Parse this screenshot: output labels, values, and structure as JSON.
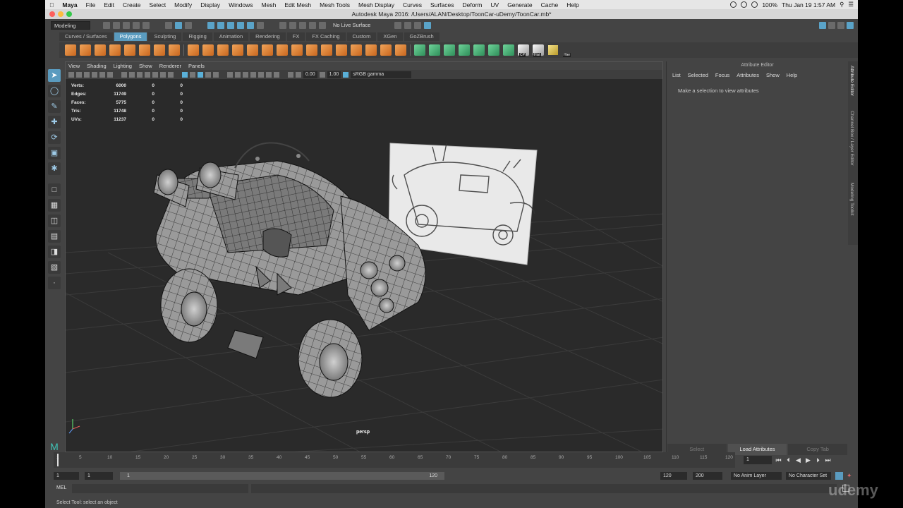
{
  "os_menubar": {
    "apple": "",
    "items": [
      "Maya",
      "File",
      "Edit",
      "Create",
      "Select",
      "Modify",
      "Display",
      "Windows",
      "Mesh",
      "Edit Mesh",
      "Mesh Tools",
      "Mesh Display",
      "Curves",
      "Surfaces",
      "Deform",
      "UV",
      "Generate",
      "Cache",
      "Help"
    ],
    "battery": "100%",
    "clock": "Thu Jan 19  1:57 AM"
  },
  "window": {
    "title": "Autodesk Maya 2016: /Users/ALAN/Desktop/ToonCar-uDemy/ToonCar.mb*"
  },
  "status_line": {
    "menu_set": "Modeling",
    "live_surface": "No Live Surface"
  },
  "shelf": {
    "tabs": [
      "Curves / Surfaces",
      "Polygons",
      "Sculpting",
      "Rigging",
      "Animation",
      "Rendering",
      "FX",
      "FX Caching",
      "Custom",
      "XGen",
      "GoZBrush"
    ],
    "active_tab": "Polygons",
    "labels": {
      "cp": "CP",
      "hist": "Hist",
      "hier": "Hier"
    }
  },
  "viewport": {
    "menu": [
      "View",
      "Shading",
      "Lighting",
      "Show",
      "Renderer",
      "Panels"
    ],
    "exposure": "0.00",
    "gamma": "1.00",
    "color_space": "sRGB gamma",
    "camera": "persp",
    "hud": [
      {
        "label": "Verts:",
        "value": "6000",
        "sel": "0",
        "comp": "0"
      },
      {
        "label": "Edges:",
        "value": "11749",
        "sel": "0",
        "comp": "0"
      },
      {
        "label": "Faces:",
        "value": "5775",
        "sel": "0",
        "comp": "0"
      },
      {
        "label": "Tris:",
        "value": "11748",
        "sel": "0",
        "comp": "0"
      },
      {
        "label": "UVs:",
        "value": "11237",
        "sel": "0",
        "comp": "0"
      }
    ]
  },
  "attribute_editor": {
    "title": "Attribute Editor",
    "menu": [
      "List",
      "Selected",
      "Focus",
      "Attributes",
      "Show",
      "Help"
    ],
    "message": "Make a selection to view attributes",
    "buttons": [
      "Select",
      "Load Attributes",
      "Copy Tab"
    ],
    "side_tabs": [
      "Attribute Editor",
      "Channel Box / Layer Editor",
      "Modeling Toolkit"
    ]
  },
  "time_slider": {
    "ticks": [
      "1",
      "5",
      "10",
      "15",
      "20",
      "25",
      "30",
      "35",
      "40",
      "45",
      "50",
      "55",
      "60",
      "65",
      "70",
      "75",
      "80",
      "85",
      "90",
      "95",
      "100",
      "105",
      "110",
      "115",
      "120"
    ],
    "current_frame": "1"
  },
  "range_slider": {
    "start": "1",
    "playback_start": "1",
    "slider_start": "1",
    "slider_end": "120",
    "playback_end": "120",
    "end": "200",
    "anim_layer": "No Anim Layer",
    "character_set": "No Character Set"
  },
  "command_line": {
    "label": "MEL"
  },
  "help_line": {
    "text": "Select Tool: select an object"
  },
  "watermark": {
    "text": "udemy"
  }
}
